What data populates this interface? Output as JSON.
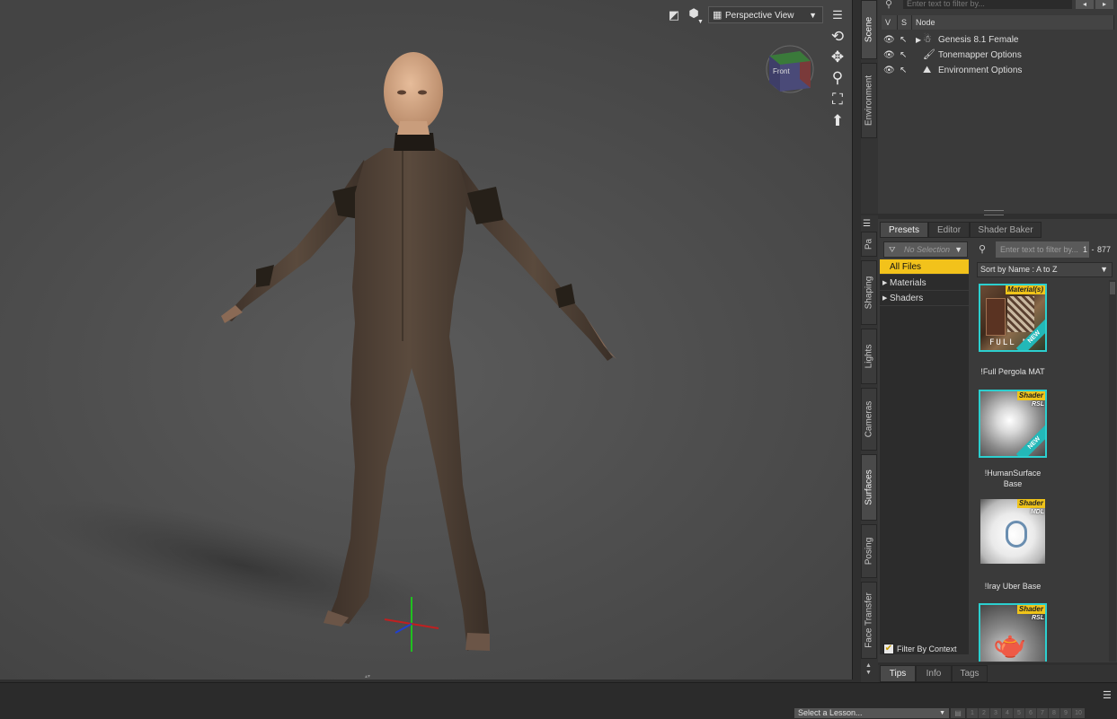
{
  "viewport": {
    "view_mode": "Perspective View",
    "cube_face": "Front",
    "icons": [
      "toggle-aux-icon",
      "draw-style-icon",
      "orbit-icon",
      "pan-icon",
      "zoom-icon",
      "frame-icon",
      "reset-icon",
      "menu-icon"
    ]
  },
  "left_tabs": [
    "Scene",
    "Environment"
  ],
  "right_tabs": [
    "Pa",
    "Shaping",
    "Lights",
    "Cameras",
    "Surfaces",
    "Posing",
    "Face Transfer"
  ],
  "scene": {
    "filter_placeholder": "Enter text to filter by...",
    "columns": [
      "V",
      "S",
      "Node"
    ],
    "nodes": [
      "Genesis 8.1 Female",
      "Tonemapper Options",
      "Environment Options"
    ]
  },
  "surfaces": {
    "tabs": [
      "Presets",
      "Editor",
      "Shader Baker"
    ],
    "selection": "No Selection",
    "filter_placeholder": "Enter text to filter by...",
    "count_start": "1",
    "count_end": "877",
    "sort_label": "Sort by Name : A to Z",
    "categories": [
      "All Files",
      "Materials",
      "Shaders"
    ],
    "filter_by_context": "Filter By Context",
    "presets": [
      {
        "label": "!Full Pergola MAT",
        "badge": "Material(s)",
        "sub": "",
        "ribbon": "NEW",
        "caption": "FULL M"
      },
      {
        "label": "!HumanSurface Base",
        "badge": "Shader",
        "sub": "RSL",
        "ribbon": "NEW",
        "caption": ""
      },
      {
        "label": "!Iray Uber Base",
        "badge": "Shader",
        "sub": "MDL",
        "ribbon": "",
        "caption": ""
      },
      {
        "label": "",
        "badge": "Shader",
        "sub": "RSL",
        "ribbon": "",
        "caption": ""
      }
    ]
  },
  "bottom_tabs": [
    "Tips",
    "Info",
    "Tags"
  ],
  "lesson": {
    "placeholder": "Select a Lesson...",
    "steps": [
      "1",
      "2",
      "3",
      "4",
      "5",
      "6",
      "7",
      "8",
      "9",
      "10"
    ]
  },
  "colors": {
    "accent": "#f2c21b",
    "thumb_border": "#2ccfcf"
  }
}
